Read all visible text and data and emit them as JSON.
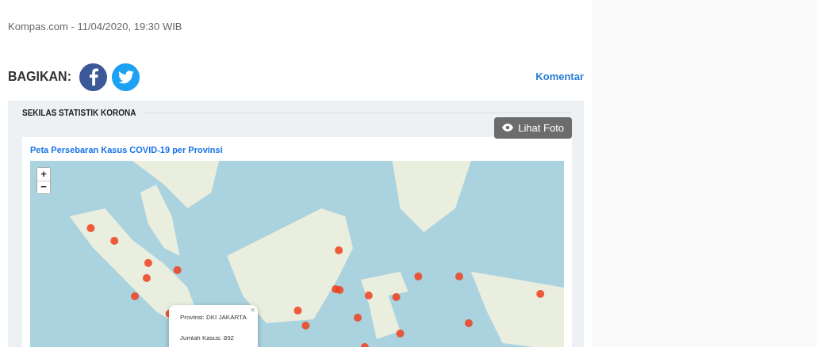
{
  "article": {
    "meta": "Kompas.com - 11/04/2020, 19:30 WIB"
  },
  "share": {
    "label": "BAGIKAN:",
    "comment_link": "Komentar"
  },
  "stats_panel": {
    "heading": "SEKILAS STATISTIK KORONA",
    "photo_button": "Lihat Foto",
    "map_card": {
      "title": "Peta Persebaran Kasus COVID-19 per Provinsi",
      "zoom_controls": [
        "+",
        "−"
      ],
      "popup": {
        "close": "×",
        "lines": [
          "Provinsi: DKI JAKARTA",
          "Jumlah Kasus: 892"
        ]
      }
    }
  }
}
